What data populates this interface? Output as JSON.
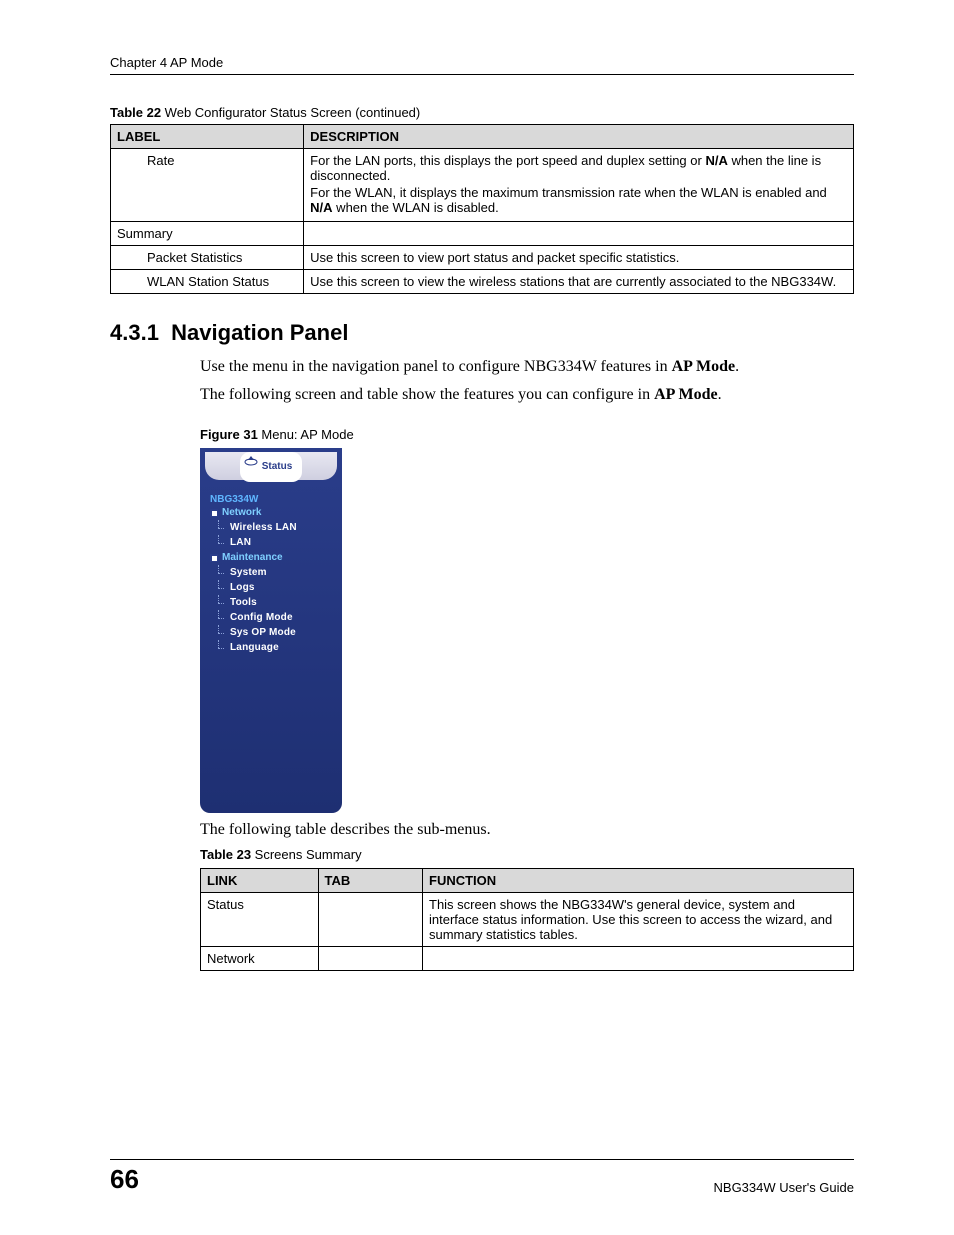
{
  "header": {
    "chapter": "Chapter 4 AP Mode"
  },
  "table22": {
    "caption_bold": "Table 22",
    "caption_rest": "   Web Configurator Status Screen (continued)",
    "head_label": "LABEL",
    "head_desc": "DESCRIPTION",
    "rows": {
      "rate_label": "Rate",
      "rate_desc_l1a": "For the LAN ports, this displays the port speed and duplex setting or ",
      "rate_desc_l1b": "N/A",
      "rate_desc_l1c": " when the line is disconnected.",
      "rate_desc_l2a": "For the WLAN, it displays the maximum transmission rate when the WLAN is enabled and ",
      "rate_desc_l2b": "N/A",
      "rate_desc_l2c": " when the WLAN is disabled.",
      "summary_label": "Summary",
      "summary_desc": "",
      "pkt_label": "Packet Statistics",
      "pkt_desc": "Use this screen to view port status and packet specific statistics.",
      "wlan_label": "WLAN Station Status",
      "wlan_desc": "Use this screen to view the wireless stations that are currently associated to the NBG334W."
    }
  },
  "section": {
    "num": "4.3.1",
    "title": "Navigation Panel",
    "p1a": "Use the menu in the navigation panel to configure NBG334W features in ",
    "p1b": "AP Mode",
    "p1c": ".",
    "p2a": "The following screen and table show the features you can configure in ",
    "p2b": "AP Mode",
    "p2c": "."
  },
  "figure31": {
    "caption_bold": "Figure 31",
    "caption_rest": "   Menu: AP Mode",
    "status_label": "Status",
    "device": "NBG334W",
    "group_network": "Network",
    "item_wlan": "Wireless LAN",
    "item_lan": "LAN",
    "group_maint": "Maintenance",
    "item_system": "System",
    "item_logs": "Logs",
    "item_tools": "Tools",
    "item_config": "Config Mode",
    "item_sysop": "Sys OP Mode",
    "item_lang": "Language"
  },
  "para_after_fig": "The following table describes the sub-menus.",
  "table23": {
    "caption_bold": "Table 23",
    "caption_rest": "   Screens Summary",
    "head_link": "LINK",
    "head_tab": "TAB",
    "head_func": "FUNCTION",
    "row1_link": "Status",
    "row1_tab": "",
    "row1_func": "This screen shows the NBG334W's general device, system and interface status information. Use this screen to access the wizard, and summary statistics tables.",
    "row2_link": "Network",
    "row2_tab": "",
    "row2_func": ""
  },
  "footer": {
    "page_num": "66",
    "guide": "NBG334W User's Guide"
  }
}
